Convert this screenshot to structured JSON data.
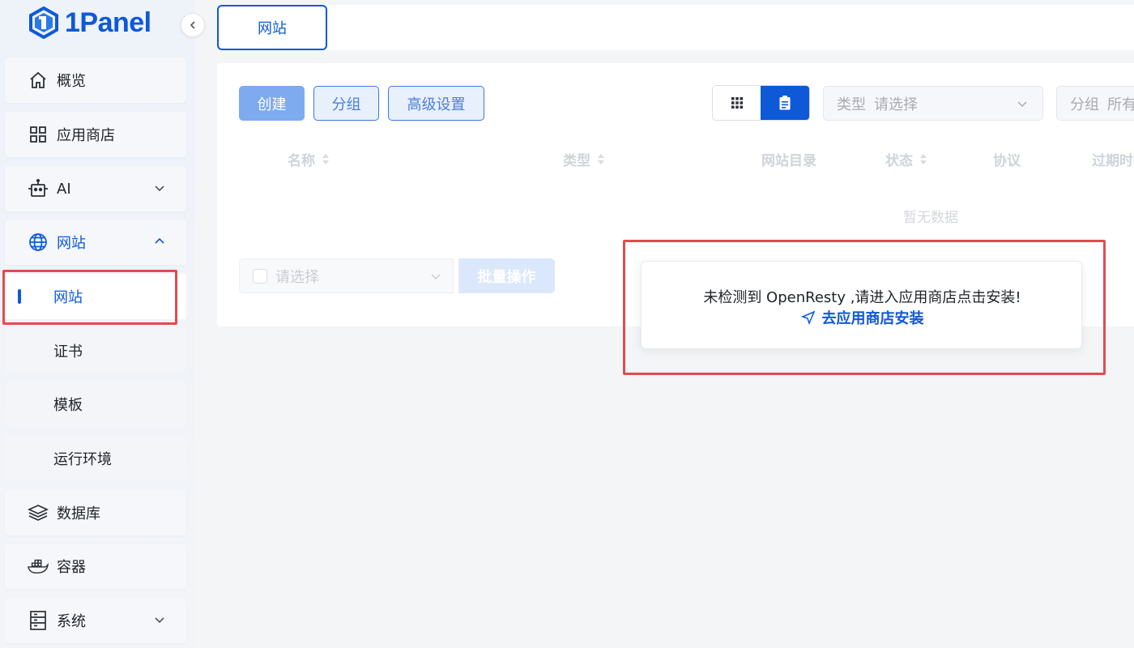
{
  "app": {
    "name": "1Panel"
  },
  "sidebar": {
    "items": [
      {
        "label": "概览",
        "icon": "home-icon"
      },
      {
        "label": "应用商店",
        "icon": "grid-icon"
      },
      {
        "label": "AI",
        "icon": "robot-icon"
      },
      {
        "label": "网站",
        "icon": "globe-icon",
        "expanded": true
      },
      {
        "label": "数据库",
        "icon": "layers-icon"
      },
      {
        "label": "容器",
        "icon": "docker-icon"
      },
      {
        "label": "系统",
        "icon": "system-icon"
      }
    ],
    "website_subitems": [
      {
        "label": "网站",
        "active": true
      },
      {
        "label": "证书"
      },
      {
        "label": "模板"
      },
      {
        "label": "运行环境"
      }
    ]
  },
  "tabs": [
    {
      "label": "网站",
      "active": true
    }
  ],
  "toolbar": {
    "create_label": "创建",
    "group_label": "分组",
    "advanced_label": "高级设置",
    "type_filter": {
      "prefix": "类型",
      "placeholder": "请选择"
    },
    "group_filter": {
      "prefix": "分组",
      "value": "所有"
    }
  },
  "table": {
    "columns": [
      "名称",
      "类型",
      "网站目录",
      "状态",
      "协议",
      "过期时"
    ],
    "empty_text": "暂无数据"
  },
  "batch": {
    "placeholder": "请选择",
    "button_label": "批量操作"
  },
  "notice": {
    "message": "未检测到 OpenResty ,请进入应用商店点击安装!",
    "link_label": "去应用商店安装"
  },
  "colors": {
    "primary": "#0d59d8",
    "highlight": "#e24b4f",
    "primary_light": "#7eaaf0"
  }
}
